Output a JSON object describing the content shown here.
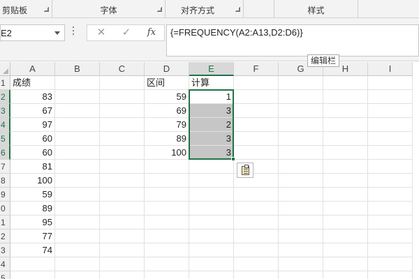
{
  "ribbon": {
    "groups": [
      {
        "label": "剪贴板"
      },
      {
        "label": "字体"
      },
      {
        "label": "对齐方式"
      },
      {
        "label": ""
      },
      {
        "label": "样式"
      },
      {
        "label": ""
      }
    ]
  },
  "formula_bar": {
    "name_box": "E2",
    "cancel_icon": "✕",
    "enter_icon": "✓",
    "fx_label": "fx",
    "formula": "{=FREQUENCY(A2:A13,D2:D6)}",
    "tooltip": "编辑栏"
  },
  "grid": {
    "columns": [
      "A",
      "B",
      "C",
      "D",
      "E",
      "F",
      "G",
      "H",
      "I"
    ],
    "selected_column": "E",
    "rows": [
      {
        "num": "1",
        "A": "成绩",
        "D": "区间",
        "E": "计算"
      },
      {
        "num": "2",
        "A": "83",
        "D": "59",
        "E": "1"
      },
      {
        "num": "3",
        "A": "67",
        "D": "69",
        "E": "3"
      },
      {
        "num": "4",
        "A": "97",
        "D": "79",
        "E": "2"
      },
      {
        "num": "5",
        "A": "60",
        "D": "89",
        "E": "3"
      },
      {
        "num": "6",
        "A": "60",
        "D": "100",
        "E": "3"
      },
      {
        "num": "7",
        "A": "81"
      },
      {
        "num": "8",
        "A": "100"
      },
      {
        "num": "9",
        "A": "59"
      },
      {
        "num": "0",
        "A": "89"
      },
      {
        "num": "1",
        "A": "95"
      },
      {
        "num": "2",
        "A": "77"
      },
      {
        "num": "3",
        "A": "74"
      },
      {
        "num": "4"
      },
      {
        "num": "5"
      }
    ],
    "selected_rows": [
      "2",
      "3",
      "4",
      "5",
      "6"
    ],
    "quick_analysis_icon": "quick-analysis-icon"
  },
  "colors": {
    "accent": "#217346",
    "selection_fill": "#c6c6c6"
  }
}
